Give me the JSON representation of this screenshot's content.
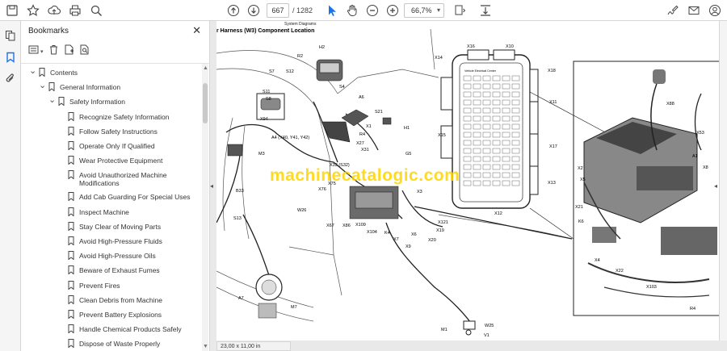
{
  "toolbar": {
    "page_current": "667",
    "page_total": "/ 1282",
    "zoom": "66,7%"
  },
  "bookmarks": {
    "title": "Bookmarks",
    "items": [
      {
        "label": "Contents",
        "level": 0,
        "expanded": true
      },
      {
        "label": "General Information",
        "level": 1,
        "expanded": true
      },
      {
        "label": "Safety Information",
        "level": 2,
        "expanded": true
      },
      {
        "label": "Recognize Safety Information",
        "level": 3
      },
      {
        "label": "Follow Safety Instructions",
        "level": 3
      },
      {
        "label": "Operate Only If Qualified",
        "level": 3
      },
      {
        "label": "Wear Protective Equipment",
        "level": 3
      },
      {
        "label": "Avoid Unauthorized Machine",
        "label2": "Modifications",
        "level": 3
      },
      {
        "label": "Add Cab Guarding For Special Uses",
        "level": 3
      },
      {
        "label": "Inspect Machine",
        "level": 3
      },
      {
        "label": "Stay Clear of Moving Parts",
        "level": 3
      },
      {
        "label": "Avoid High-Pressure Fluids",
        "level": 3
      },
      {
        "label": "Avoid High-Pressure Oils",
        "level": 3
      },
      {
        "label": "Beware of Exhaust Fumes",
        "level": 3
      },
      {
        "label": "Prevent Fires",
        "level": 3
      },
      {
        "label": "Clean Debris from Machine",
        "level": 3
      },
      {
        "label": "Prevent Battery Explosions",
        "level": 3
      },
      {
        "label": "Handle Chemical Products Safely",
        "level": 3
      },
      {
        "label": "Dispose of Waste Properly",
        "level": 3
      }
    ]
  },
  "document": {
    "title": "r Harness (W3) Component Location",
    "subtitle": "System Diagrams",
    "watermark": "machinecatalogic.com",
    "page_size": "23,00 x 11,00 in",
    "labels": [
      "H2",
      "R2",
      "S7",
      "S12",
      "S11",
      "S8",
      "S4",
      "A6",
      "X94",
      "M3",
      "R4",
      "X1",
      "S21",
      "H1",
      "G5",
      "A4 (Y40, Y41, Y42)",
      "X27",
      "X31",
      "X33 (S32)",
      "B33",
      "X75",
      "X76",
      "X3",
      "W26",
      "S13",
      "X67",
      "X86",
      "X109",
      "X104",
      "K4",
      "X7",
      "X9",
      "X6",
      "X20",
      "X19",
      "X121",
      "A7",
      "M7",
      "M1",
      "W25",
      "V1",
      "X16",
      "X10",
      "X14",
      "X18",
      "X11",
      "X15",
      "X17",
      "X13",
      "X12",
      "A1",
      "X2",
      "X5",
      "X8",
      "X21",
      "K6",
      "X4",
      "X22",
      "X103",
      "X53",
      "X88",
      "R4"
    ],
    "fuse_box_title": "Vehicle Electrical Center"
  }
}
